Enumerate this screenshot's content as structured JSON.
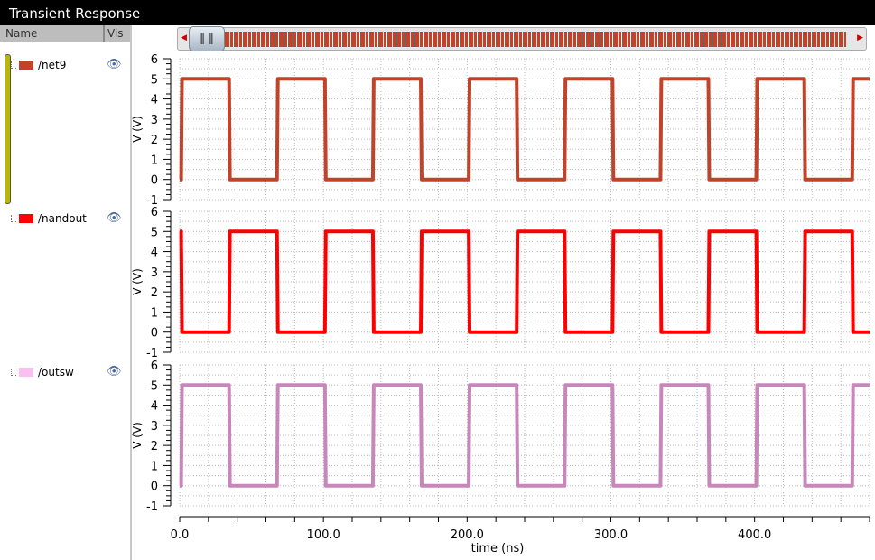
{
  "window": {
    "title": "Transient Response"
  },
  "legend_header": {
    "name": "Name",
    "vis": "Vis"
  },
  "signals": [
    {
      "name": "/net9",
      "color": "#c0432a"
    },
    {
      "name": "/nandout",
      "color": "#ff0000"
    },
    {
      "name": "/outsw",
      "color": "#c887bb"
    }
  ],
  "chart_data": {
    "type": "line",
    "xlabel": "time (ns)",
    "ylabel": "V (V)",
    "xlim": [
      0,
      480
    ],
    "ylim": [
      -1,
      6
    ],
    "xticks": [
      "0.0",
      "100.0",
      "200.0",
      "300.0",
      "400.0"
    ],
    "yticks": [
      "6",
      "5",
      "4",
      "3",
      "2",
      "1",
      "0",
      "-1"
    ],
    "grid": true,
    "period_ns": 66.7,
    "series": [
      {
        "name": "/net9",
        "low": 0,
        "high": 5,
        "first_rise_ns": 1,
        "initial": "low"
      },
      {
        "name": "/nandout",
        "low": 0,
        "high": 5,
        "first_fall_ns": 1,
        "initial": "high"
      },
      {
        "name": "/outsw",
        "low": 0,
        "high": 5,
        "first_rise_ns": 1,
        "initial": "low"
      }
    ]
  }
}
